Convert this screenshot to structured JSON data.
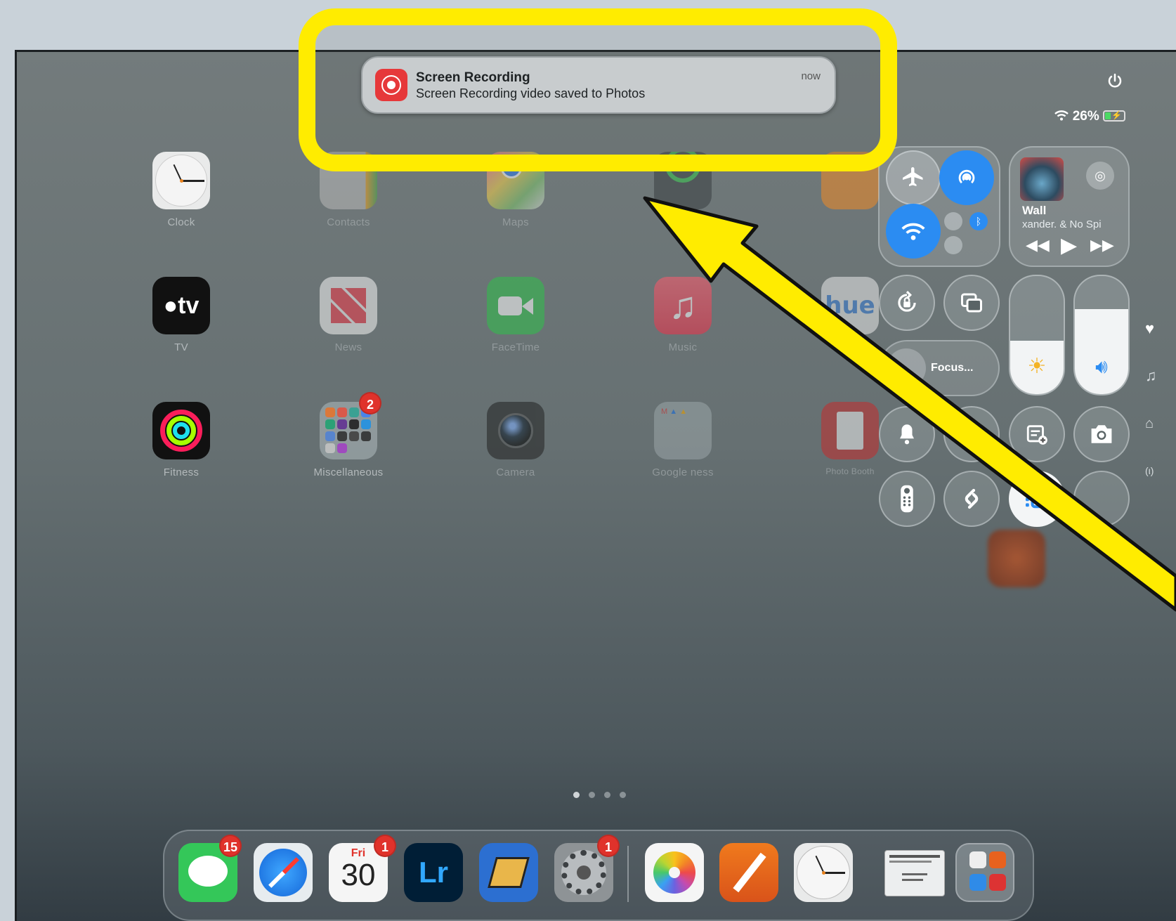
{
  "notification": {
    "title": "Screen Recording",
    "body": "Screen Recording video saved to Photos",
    "time": "now"
  },
  "status_bar": {
    "battery_percent": "26%",
    "charging": true
  },
  "apps_row1": [
    {
      "label": "Clock"
    },
    {
      "label": "Contacts"
    },
    {
      "label": "Maps"
    },
    {
      "label": "Find My"
    },
    {
      "label": "Books"
    }
  ],
  "apps_row2": [
    {
      "label": "TV"
    },
    {
      "label": "News"
    },
    {
      "label": "FaceTime"
    },
    {
      "label": "Music"
    }
  ],
  "apps_row3": [
    {
      "label": "Fitness"
    },
    {
      "label": "Miscellaneous",
      "badge": "2"
    },
    {
      "label": "Camera"
    },
    {
      "label": "Google ness"
    },
    {
      "label": "Photo Booth"
    }
  ],
  "tv_icon_text": "tv",
  "control_center": {
    "now_playing": {
      "title": "Wall",
      "artist": "xander. & No Spi"
    },
    "focus_label": "Focus...",
    "brightness_level": 0.45,
    "volume_level": 0.72
  },
  "page_dots": {
    "count": 4,
    "current": 1
  },
  "dock": {
    "messages_badge": "15",
    "calendar_day": "Fri",
    "calendar_date": "30",
    "calendar_badge": "1",
    "settings_badge": "1",
    "lightroom_text": "Lr"
  },
  "colors": {
    "annotation_yellow": "#ffec00",
    "control_blue": "#2b8cf2",
    "badge_red": "#e0322b"
  }
}
